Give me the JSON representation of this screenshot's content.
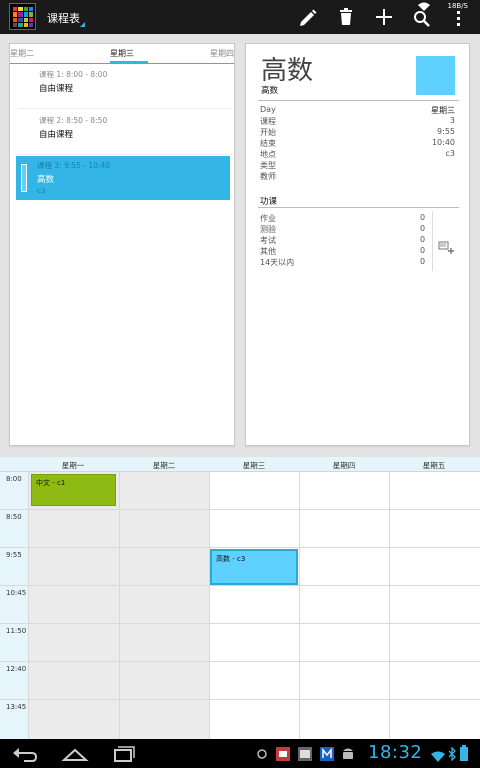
{
  "app": {
    "title": "课程表",
    "net_speed": "18B/S"
  },
  "colors": {
    "accent": "#33b5e5",
    "selected_lesson": "#33b5e5",
    "lesson_color": "#5fd1ff",
    "chinese_event": "#8fba13",
    "header_bg": "#e6f4fb"
  },
  "actions": [
    "edit-icon",
    "delete-icon",
    "add-icon",
    "search-icon",
    "overflow-menu-icon"
  ],
  "day_tabs": {
    "prev": "星期二",
    "current": "星期三",
    "next": "星期四"
  },
  "lessons": [
    {
      "time": "课程 1: 8:00 - 8:00",
      "name": "自由课程",
      "location": ""
    },
    {
      "time": "课程 2: 8:50 - 8:50",
      "name": "自由课程",
      "location": ""
    },
    {
      "time": "课程 3: 9:55 - 10:40",
      "name": "高数",
      "location": "c3"
    }
  ],
  "detail": {
    "title": "高数",
    "subtitle": "高数",
    "props": [
      {
        "label": "Day",
        "value": "星期三"
      },
      {
        "label": "课程",
        "value": "3"
      },
      {
        "label": "开始",
        "value": "9:55"
      },
      {
        "label": "结束",
        "value": "10:40"
      },
      {
        "label": "地点",
        "value": "c3"
      },
      {
        "label": "类型",
        "value": ""
      },
      {
        "label": "教师",
        "value": ""
      }
    ],
    "homework_title": "功课",
    "homework": [
      {
        "label": "作业",
        "value": "0"
      },
      {
        "label": "测验",
        "value": "0"
      },
      {
        "label": "考试",
        "value": "0"
      },
      {
        "label": "其他",
        "value": "0"
      },
      {
        "label": "14天以内",
        "value": "0"
      }
    ]
  },
  "timetable": {
    "days": [
      "星期一",
      "星期二",
      "星期三",
      "星期四",
      "星期五"
    ],
    "times": [
      "8:00",
      "8:50",
      "9:55",
      "10:45",
      "11:50",
      "12:40",
      "13:45"
    ],
    "events": [
      {
        "label": "中文 - c1",
        "day": "星期一",
        "time": "8:00"
      },
      {
        "label": "高数 - c3",
        "day": "星期三",
        "time": "9:55"
      }
    ]
  },
  "statusbar": {
    "clock": "18:32"
  }
}
